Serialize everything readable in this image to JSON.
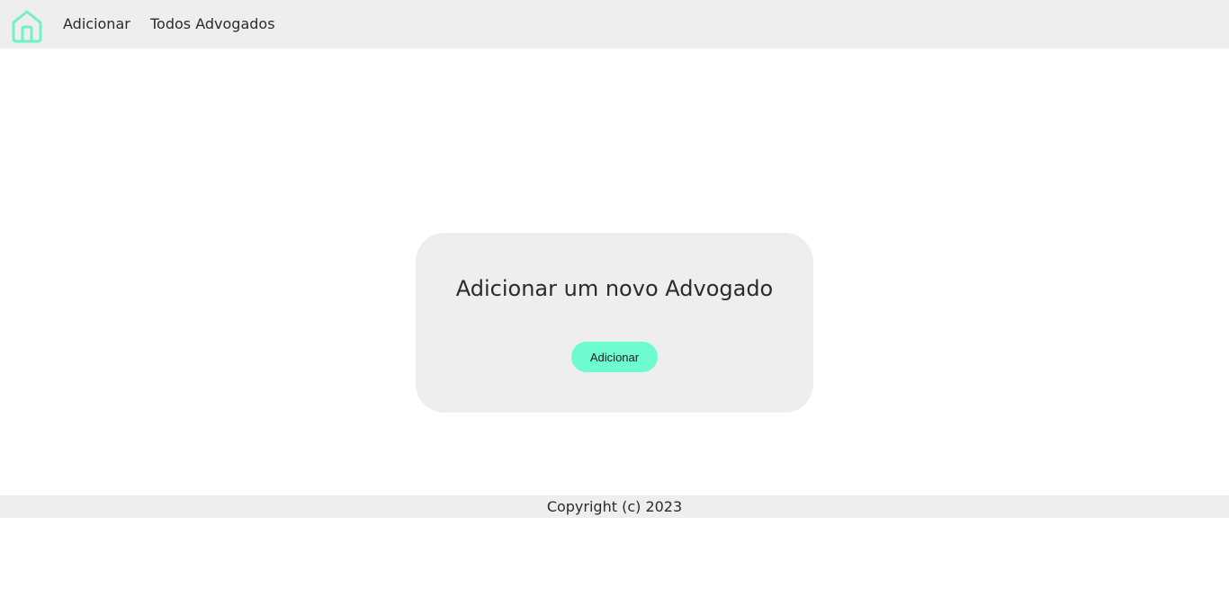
{
  "nav": {
    "home_icon": "home-icon",
    "accent_color": "#6ff2c4",
    "links": [
      {
        "label": "Adicionar"
      },
      {
        "label": "Todos Advogados"
      }
    ]
  },
  "card": {
    "title": "Adicionar um novo Advogado",
    "button_label": "Adicionar",
    "button_color": "#6ffbd0"
  },
  "footer": {
    "text": "Copyright (c) 2023"
  }
}
